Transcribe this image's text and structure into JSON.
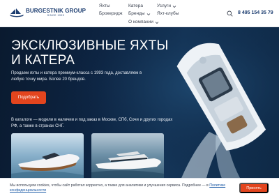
{
  "brand": {
    "name": "BURGESTNIK GROUP",
    "sub": "SINCE 1993"
  },
  "nav": {
    "yachts": "Яхты",
    "boats": "Катера",
    "services": "Услуги",
    "brokerage": "Брокеридж",
    "brands": "Бренды",
    "yacht_clubs": "Яхт-клубы",
    "about": "О компании"
  },
  "contact": {
    "phone": "8 495 154 35 79"
  },
  "hero": {
    "title_line1": "ЭКСКЛЮЗИВНЫЕ ЯХТЫ",
    "title_line2": "И КАТЕРА",
    "description": "Продаем яхты и катера премиум-класса с 1993 года, доставляем в любую точку мира. Более 20 брендов.",
    "cta_label": "Подобрать",
    "catalog_note": "В каталоге — модели в наличии и под заказ в Москве, СПб, Сочи и других городах РФ, а также в странах СНГ."
  },
  "cookie": {
    "text": "Мы используем cookies, чтобы сайт работал корректно, а также для аналитики и улучшения сервиса. Подробнее — в ",
    "link": "Политике конфиденциальности",
    "accept_label": "Принять"
  },
  "icons": {
    "search": "search-icon",
    "chevron": "chevron-down-icon"
  },
  "colors": {
    "accent": "#e3451e",
    "brand": "#1c3d70",
    "hero_bg": "#0d2442"
  }
}
